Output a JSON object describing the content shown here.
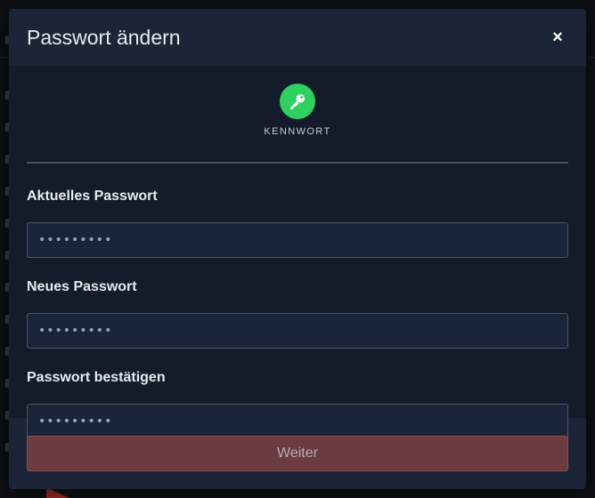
{
  "modal": {
    "title": "Passwort ändern",
    "close_label": "×",
    "icon": {
      "name": "key-icon",
      "color": "#2ed15f",
      "label": "KENNWORT"
    },
    "fields": [
      {
        "label": "Aktuelles Passwort",
        "value": "•••••••••"
      },
      {
        "label": "Neues Passwort",
        "value": "•••••••••"
      },
      {
        "label": "Passwort bestätigen",
        "value": "•••••••••"
      }
    ],
    "submit_label": "Weiter",
    "colors": {
      "header_bg": "#1c2537",
      "body_bg": "#141b2b",
      "submit_bg": "#6a3b3f"
    }
  }
}
